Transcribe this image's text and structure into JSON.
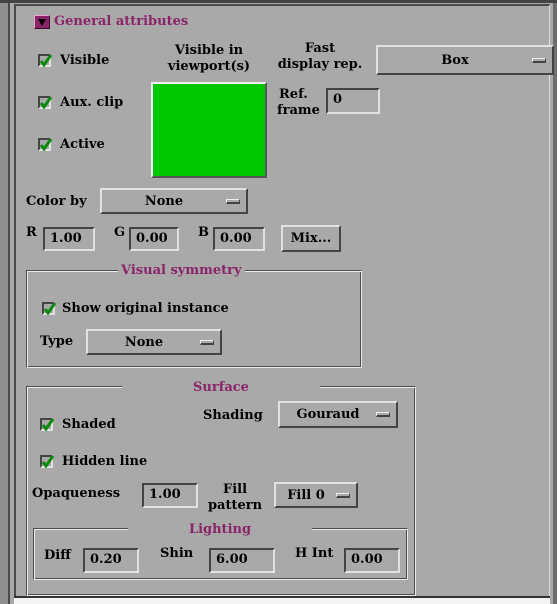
{
  "general": {
    "header": "General attributes",
    "visible_label": "Visible",
    "visible_checked": true,
    "aux_clip_label": "Aux. clip",
    "aux_clip_checked": true,
    "active_label": "Active",
    "active_checked": true,
    "viewport_label_1": "Visible in",
    "viewport_label_2": "viewport(s)",
    "viewport_color": "#00c800",
    "fast_display_label_1": "Fast",
    "fast_display_label_2": "display rep.",
    "fast_display_value": "Box",
    "ref_frame_label_1": "Ref.",
    "ref_frame_label_2": "frame",
    "ref_frame_value": "0"
  },
  "color": {
    "color_by_label": "Color by",
    "color_by_value": "None",
    "r_label": "R",
    "r_value": "1.00",
    "g_label": "G",
    "g_value": "0.00",
    "b_label": "B",
    "b_value": "0.00",
    "mix_label": "Mix..."
  },
  "symmetry": {
    "title": "Visual symmetry",
    "show_original_label": "Show original instance",
    "show_original_checked": true,
    "type_label": "Type",
    "type_value": "None"
  },
  "surface": {
    "title": "Surface",
    "shaded_label": "Shaded",
    "shaded_checked": true,
    "hidden_line_label": "Hidden line",
    "hidden_line_checked": true,
    "shading_label": "Shading",
    "shading_value": "Gouraud",
    "opaqueness_label": "Opaqueness",
    "opaqueness_value": "1.00",
    "fill_label_1": "Fill",
    "fill_label_2": "pattern",
    "fill_value": "Fill 0"
  },
  "lighting": {
    "title": "Lighting",
    "diff_label": "Diff",
    "diff_value": "0.20",
    "shin_label": "Shin",
    "shin_value": "6.00",
    "hint_label": "H Int",
    "hint_value": "0.00"
  },
  "colors": {
    "panel_bg": "#a9a9a9",
    "title_purple": "#8a2468",
    "check_mark": "#0a8a0a",
    "swatch_green": "#00c800"
  }
}
